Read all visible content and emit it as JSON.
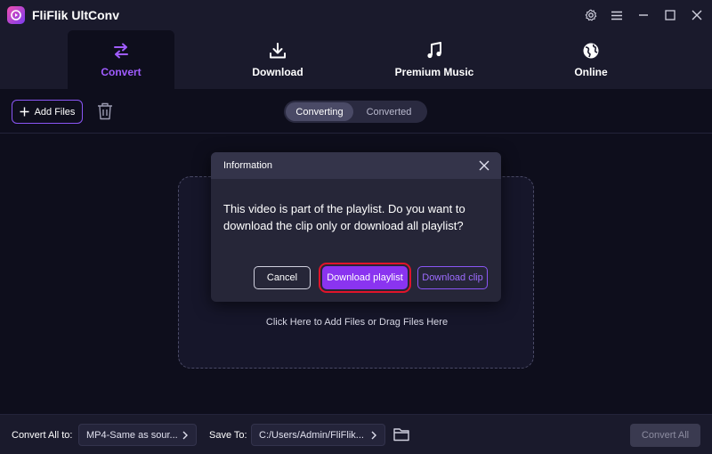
{
  "app": {
    "title": "FliFlik UltConv",
    "brand_gradient": [
      "#f04fb0",
      "#7b3cf0"
    ],
    "accent": "#8a56f5"
  },
  "window_controls": [
    {
      "name": "settings",
      "icon": "gear-icon"
    },
    {
      "name": "menu",
      "icon": "hamburger-icon"
    },
    {
      "name": "minimize",
      "icon": "minimize-icon"
    },
    {
      "name": "maximize",
      "icon": "maximize-icon"
    },
    {
      "name": "close",
      "icon": "close-icon"
    }
  ],
  "nav": {
    "tabs": [
      {
        "label": "Convert",
        "icon": "convert-arrows-icon",
        "active": true
      },
      {
        "label": "Download",
        "icon": "download-icon",
        "active": false
      },
      {
        "label": "Premium Music",
        "icon": "music-note-icon",
        "active": false
      },
      {
        "label": "Online",
        "icon": "globe-icon",
        "active": false
      }
    ]
  },
  "toolbar": {
    "add_files_label": "Add Files",
    "segment": {
      "options": [
        "Converting",
        "Converted"
      ],
      "selected": "Converting"
    }
  },
  "dropzone": {
    "text": "Click Here to Add Files or Drag Files Here"
  },
  "dialog": {
    "title": "Information",
    "message": "This video is part of the playlist. Do you want to download the clip only or download all playlist?",
    "buttons": {
      "cancel": "Cancel",
      "playlist": "Download playlist",
      "clip": "Download clip"
    },
    "highlight_color": "#e0142a"
  },
  "bottombar": {
    "convert_all_to_label": "Convert All to:",
    "format_value": "MP4-Same as sour...",
    "save_to_label": "Save To:",
    "save_path": "C:/Users/Admin/FliFlik...",
    "convert_all_button": "Convert All"
  }
}
